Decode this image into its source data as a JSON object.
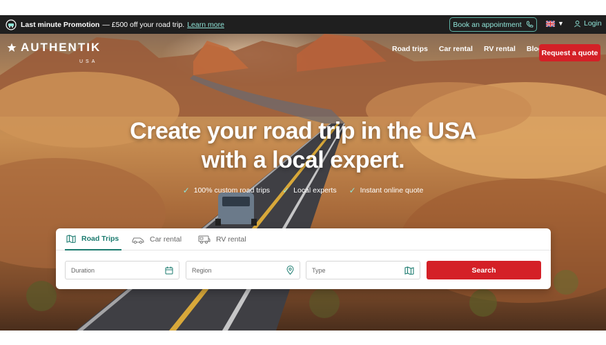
{
  "promo": {
    "title": "Last minute Promotion",
    "text": "— £500 off your road trip.",
    "link": "Learn more"
  },
  "topbar": {
    "book_label": "Book an appointment",
    "lang_caret": "▼",
    "login_label": "Login"
  },
  "logo": {
    "name": "AUTHENTIK",
    "sub": "USA"
  },
  "nav": {
    "items": [
      "Road trips",
      "Car rental",
      "RV rental",
      "Blog"
    ],
    "quote_label": "Request a quote"
  },
  "hero": {
    "headline_line1": "Create your road trip in the USA",
    "headline_line2": "with a local expert.",
    "features": [
      "100% custom road trips",
      "Local experts",
      "Instant online quote"
    ]
  },
  "search": {
    "tabs": [
      "Road Trips",
      "Car rental",
      "RV rental"
    ],
    "fields": {
      "duration": "Duration",
      "region": "Region",
      "type": "Type"
    },
    "button": "Search"
  },
  "colors": {
    "accent": "#1a7a6e",
    "cta": "#d42027",
    "topbar_bg": "#1f1f1f"
  },
  "icons": {
    "promo": "van-badge-icon",
    "phone": "phone-icon",
    "flag": "uk-flag-icon",
    "user": "user-icon",
    "star": "star-icon",
    "check": "check-icon",
    "map": "map-icon",
    "car": "car-icon",
    "rv": "rv-icon",
    "calendar": "calendar-icon",
    "pin": "location-pin-icon"
  }
}
